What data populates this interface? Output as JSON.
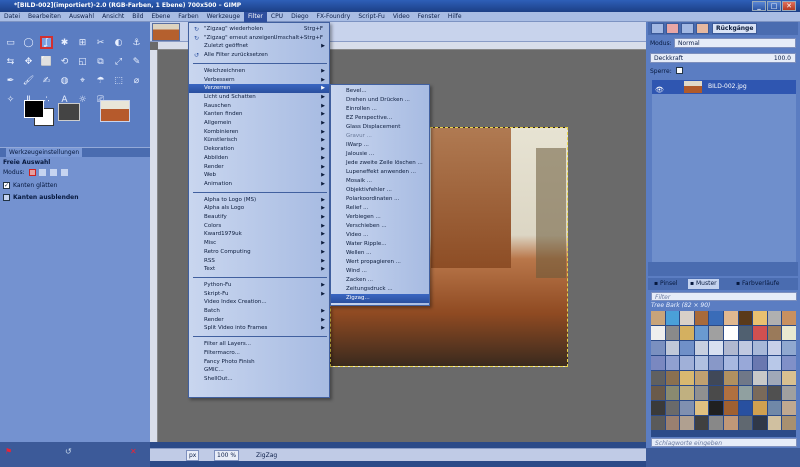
{
  "window": {
    "title": "*[BILD-002](importiert)-2.0 (RGB-Farben, 1 Ebene) 700x500 – GIMP",
    "controls": [
      "_",
      "□",
      "✕"
    ]
  },
  "menubar": [
    "Datei",
    "Bearbeiten",
    "Auswahl",
    "Ansicht",
    "Bild",
    "Ebene",
    "Farben",
    "Werkzeuge",
    "Filter",
    "CPU",
    "Diego",
    "FX-Foundry",
    "Script-Fu",
    "Video",
    "Fenster",
    "Hilfe"
  ],
  "toolbox": {
    "tools": [
      "▭",
      "◯",
      "ʆ",
      "✱",
      "⊞",
      "✂",
      "◐",
      "⚓",
      "⇆",
      "✥",
      "⬜",
      "⟲",
      "◱",
      "⧉",
      "⤢",
      "✎",
      "✒",
      "🖌",
      "✍",
      "◍",
      "⌖",
      "☂",
      "⬚",
      "⌀",
      "✧",
      "Ⅱ",
      "∴",
      "A",
      "☼",
      "⎚"
    ],
    "selected_tool_index": 2,
    "tab_label": "Werkzeugeinstellungen",
    "options_title": "Freie Auswahl",
    "mode_label": "Modus:",
    "antialias_label": "Kanten glätten",
    "feather_label": "Kanten ausblenden"
  },
  "canvas": {
    "unit": "px",
    "zoom": "100 %",
    "status_text": "ZigZag"
  },
  "filter_menu": [
    {
      "label": "\"Zigzag\" wiederholen",
      "shortcut": "Strg+F",
      "icon": "↻"
    },
    {
      "label": "\"Zigzag\" erneut anzeigen",
      "shortcut": "Umschalt+Strg+F",
      "icon": "↻"
    },
    {
      "label": "Zuletzt geöffnet",
      "arrow": true
    },
    {
      "label": "Alle Filter zurücksetzen",
      "icon": "↺"
    },
    {
      "sep": true
    },
    {
      "label": "Weichzeichnen",
      "arrow": true
    },
    {
      "label": "Verbessern",
      "arrow": true
    },
    {
      "label": "Verzerren",
      "arrow": true,
      "highlight": true
    },
    {
      "label": "Licht und Schatten",
      "arrow": true
    },
    {
      "label": "Rauschen",
      "arrow": true
    },
    {
      "label": "Kanten finden",
      "arrow": true
    },
    {
      "label": "Allgemein",
      "arrow": true
    },
    {
      "label": "Kombinieren",
      "arrow": true
    },
    {
      "label": "Künstlerisch",
      "arrow": true
    },
    {
      "label": "Dekoration",
      "arrow": true
    },
    {
      "label": "Abbilden",
      "arrow": true
    },
    {
      "label": "Render",
      "arrow": true
    },
    {
      "label": "Web",
      "arrow": true
    },
    {
      "label": "Animation",
      "arrow": true
    },
    {
      "sep": true
    },
    {
      "label": "Alpha to Logo (MS)",
      "arrow": true
    },
    {
      "label": "Alpha als Logo",
      "arrow": true
    },
    {
      "label": "Beautify",
      "arrow": true
    },
    {
      "label": "Colors",
      "arrow": true
    },
    {
      "label": "Kward1979uk",
      "arrow": true
    },
    {
      "label": "Misc",
      "arrow": true
    },
    {
      "label": "Retro Computing",
      "arrow": true
    },
    {
      "label": "RSS",
      "arrow": true
    },
    {
      "label": "Text",
      "arrow": true
    },
    {
      "sep": true
    },
    {
      "label": "Python-Fu",
      "arrow": true
    },
    {
      "label": "Skript-Fu",
      "arrow": true
    },
    {
      "label": "Video Index Creation...",
      "arrow": false
    },
    {
      "label": "Batch",
      "arrow": true
    },
    {
      "label": "Render",
      "arrow": true
    },
    {
      "label": "Split Video into Frames",
      "arrow": true
    },
    {
      "sep": true
    },
    {
      "label": "Filter all Layers..."
    },
    {
      "label": "Filtermacro..."
    },
    {
      "label": "Fancy Photo Finish"
    },
    {
      "label": "GMIC..."
    },
    {
      "label": "ShellOut..."
    }
  ],
  "submenu": [
    {
      "label": "Bevel..."
    },
    {
      "label": "Drehen und Drücken ..."
    },
    {
      "label": "Einrollen ..."
    },
    {
      "label": "EZ Perspective..."
    },
    {
      "label": "Glass Displacement"
    },
    {
      "label": "Gravur ...",
      "disabled": true
    },
    {
      "label": "IWarp ..."
    },
    {
      "label": "Jalousie ..."
    },
    {
      "label": "Jede zweite Zeile löschen ..."
    },
    {
      "label": "Lupeneffekt anwenden ..."
    },
    {
      "label": "Mosaik ..."
    },
    {
      "label": "Objektivfehler ..."
    },
    {
      "label": "Polarkoordinaten ..."
    },
    {
      "label": "Relief ..."
    },
    {
      "label": "Verbiegen ..."
    },
    {
      "label": "Verschieben ..."
    },
    {
      "label": "Video ..."
    },
    {
      "label": "Water Ripple..."
    },
    {
      "label": "Wellen ..."
    },
    {
      "label": "Wert propagieren ..."
    },
    {
      "label": "Wind ..."
    },
    {
      "label": "Zacken ..."
    },
    {
      "label": "Zeitungsdruck ..."
    },
    {
      "label": "Zigzag...",
      "highlight": true
    }
  ],
  "layers": {
    "undo_label": "Rückgänge",
    "mode_label": "Modus:",
    "mode_value": "Normal",
    "opacity_label": "Deckkraft",
    "opacity_value": "100.0",
    "lock_label": "Sperre:",
    "layer_name": "BILD-002.jpg"
  },
  "patterns": {
    "tabs": [
      "Pinsel",
      "Muster",
      "Farbverläufe"
    ],
    "filter_placeholder": "Filter",
    "current": "Tree Bark (82 × 90)",
    "search_placeholder": "Schlagworte eingeben",
    "colors": [
      "#c8a47a",
      "#4aa0d8",
      "#d8d0c8",
      "#a86a3a",
      "#3a6cb8",
      "#e0b890",
      "#5a3a1a",
      "#e8c070",
      "#b0b0b0",
      "#c89060",
      "#eeeeee",
      "#8a8a8a",
      "#d4b060",
      "#6a9ad0",
      "#a0a0a0",
      "#ffffff",
      "#506070",
      "#d05050",
      "#9a7a5a",
      "#e8e8d0",
      "#7a90c0",
      "#c0c8d8",
      "#7090c8",
      "#c8d0e0",
      "#d8e0f0",
      "#b0b8d0",
      "#c0c8e0",
      "#a8b8d8",
      "#c8d0e8",
      "#90a8d0",
      "#7a88c0",
      "#90a0d0",
      "#a0b0d8",
      "#b0c0e0",
      "#8898c8",
      "#a8b8e0",
      "#98a8d8",
      "#6a78b0",
      "#b8c8e8",
      "#8090c8",
      "#606060",
      "#8a7050",
      "#d8b870",
      "#c0a070",
      "#404858",
      "#b09060",
      "#707888",
      "#c8c8c8",
      "#a0a8b8",
      "#d8c090",
      "#6a5a4a",
      "#8a8a70",
      "#c0b080",
      "#909090",
      "#4a4a4a",
      "#b07040",
      "#90a0a0",
      "#7a6a5a",
      "#505050",
      "#a0a0a0",
      "#3a3a3a",
      "#6a6a6a",
      "#8090b0",
      "#e0c080",
      "#202020",
      "#a06030",
      "#2850a0",
      "#d0a050",
      "#7088a8",
      "#c0a890",
      "#5a5a5a",
      "#9a8070",
      "#b0a090",
      "#404040",
      "#888",
      "#c09878",
      "#606870",
      "#303848",
      "#d0c0a0",
      "#a89070"
    ]
  }
}
